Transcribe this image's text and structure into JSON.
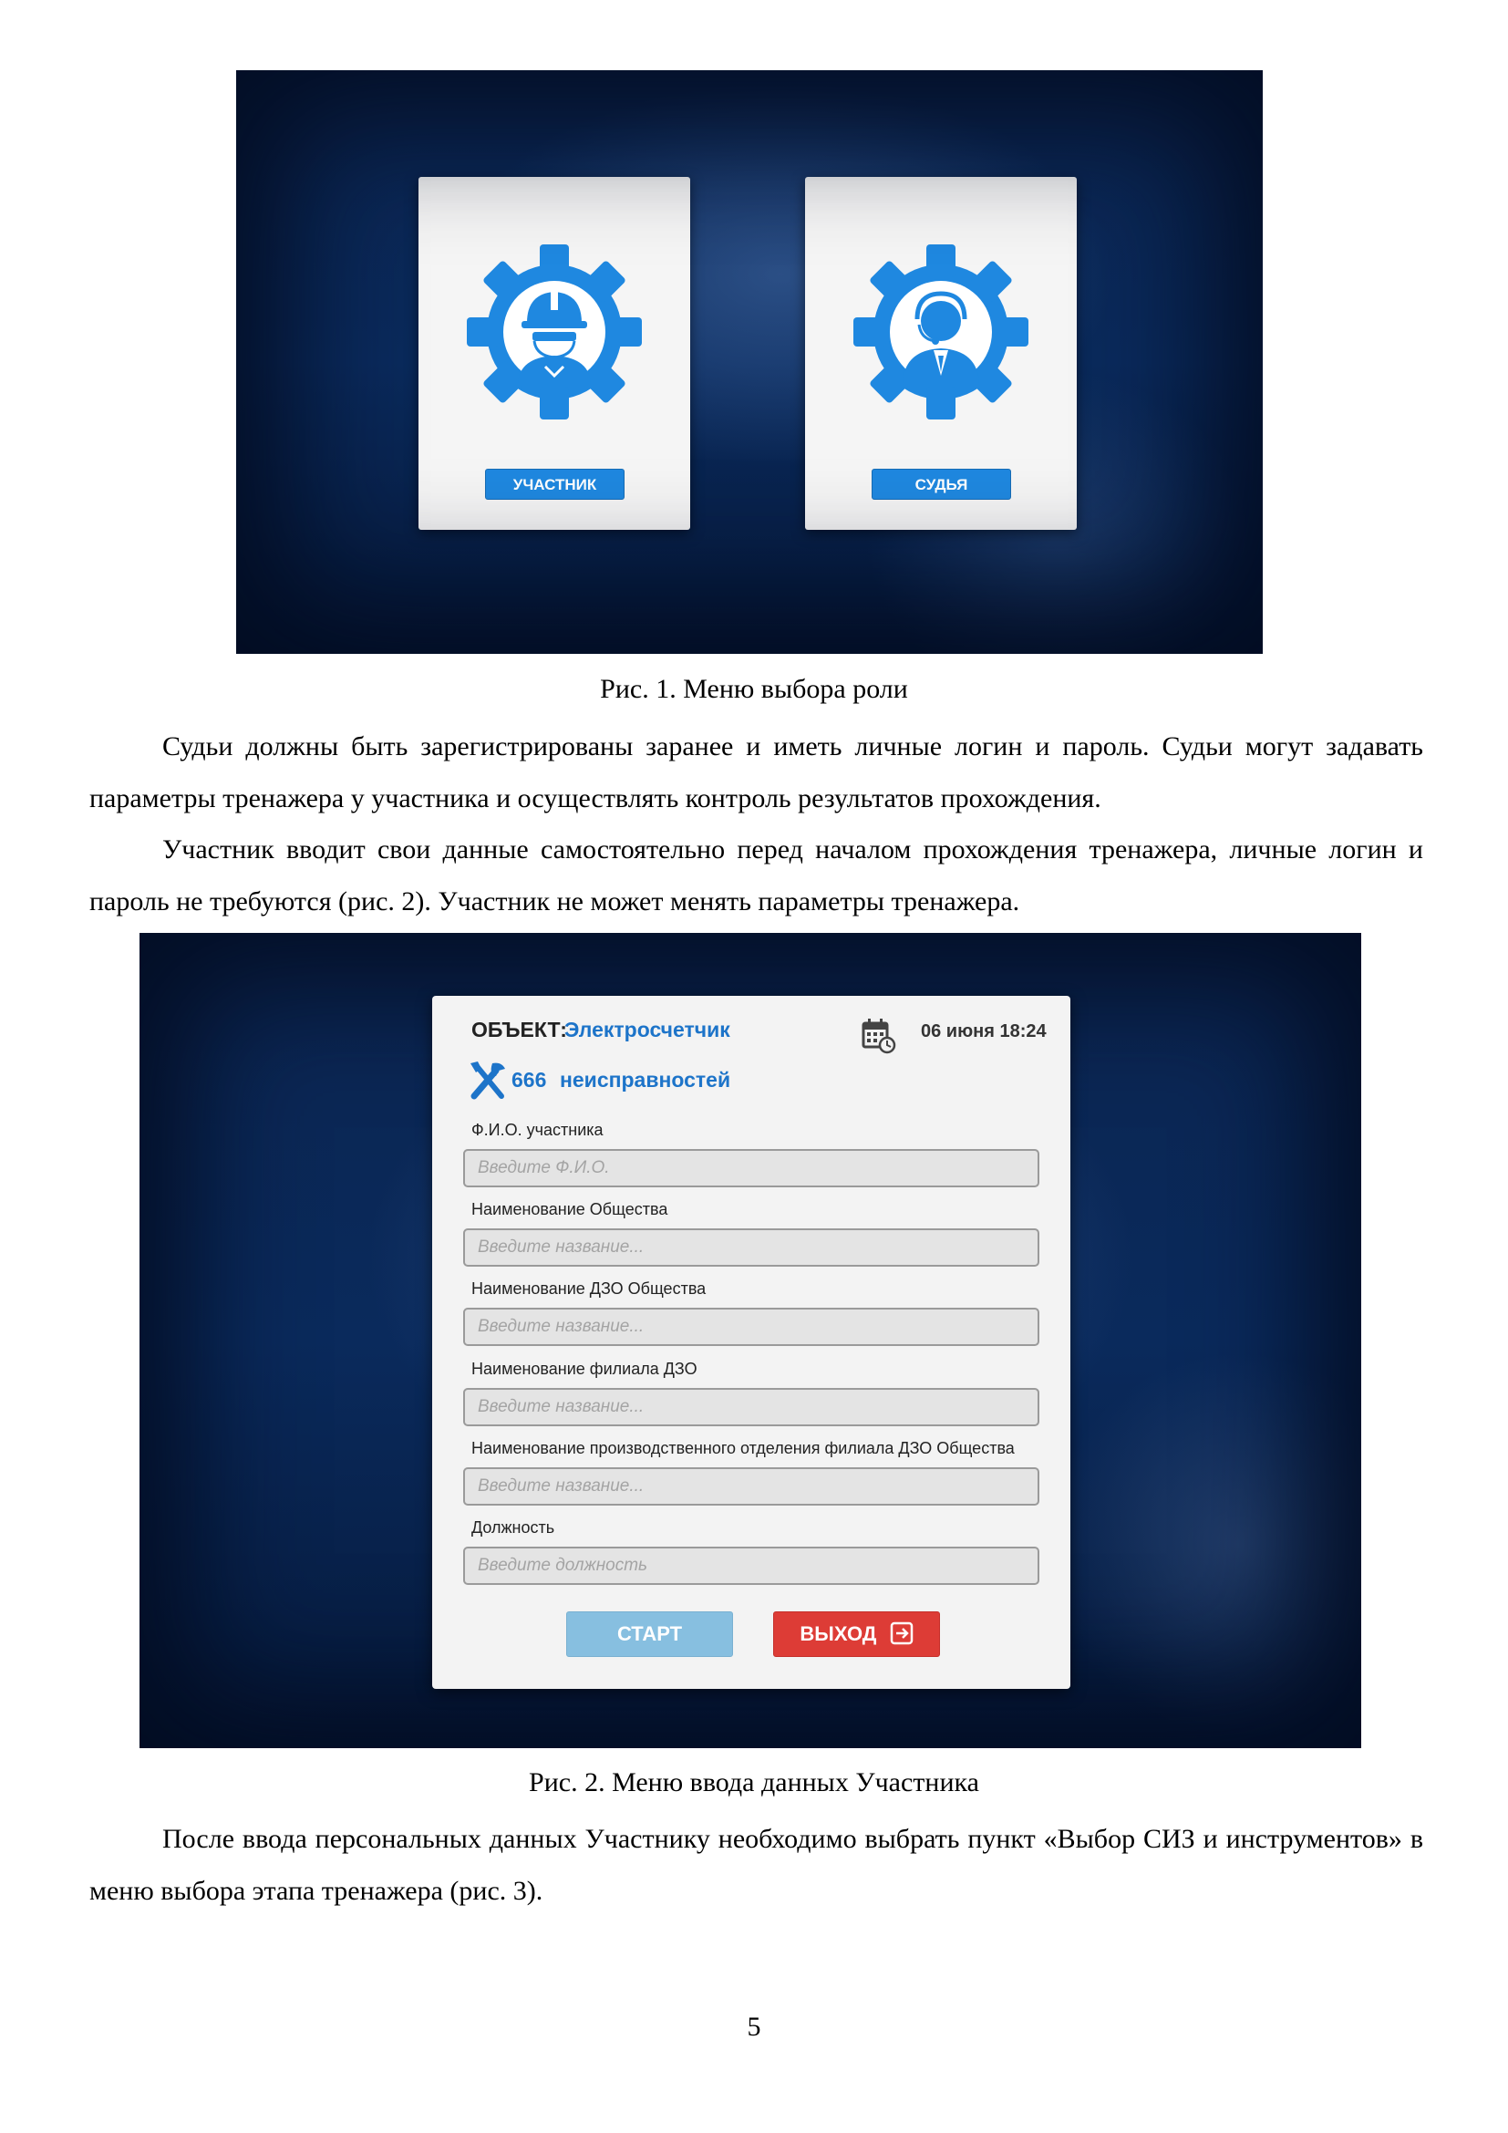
{
  "figure1": {
    "cards": [
      {
        "button_label": "УЧАСТНИК",
        "icon": "worker-gear-icon"
      },
      {
        "button_label": "СУДЬЯ",
        "icon": "operator-gear-icon"
      }
    ],
    "caption": "Рис. 1. Меню выбора роли"
  },
  "paragraphs": [
    "Судьи должны быть зарегистрированы заранее и иметь личные логин и пароль. Судьи могут задавать параметры тренажера у участника и осуществлять контроль результатов прохождения.",
    "Участник вводит свои данные самостоятельно перед началом прохождения тренажера, личные логин и пароль не требуются (рис. 2). Участник не может менять параметры тренажера.",
    "После ввода персональных данных Участнику необходимо выбрать пункт «Выбор СИЗ и инструментов» в меню выбора этапа тренажера (рис. 3)."
  ],
  "figure2": {
    "object_label": "ОБЪЕКТ:",
    "object_value": "Электросчетчик",
    "date": "06 июня 18:24",
    "fault_count": "666",
    "fault_text": "неисправностей",
    "fields": [
      {
        "label": "Ф.И.О. участника",
        "placeholder": "Введите Ф.И.О."
      },
      {
        "label": "Наименование Общества",
        "placeholder": "Введите название..."
      },
      {
        "label": "Наименование ДЗО Общества",
        "placeholder": "Введите название..."
      },
      {
        "label": "Наименование филиала ДЗО",
        "placeholder": "Введите название..."
      },
      {
        "label": "Наименование производственного отделения филиала ДЗО Общества",
        "placeholder": "Введите название..."
      },
      {
        "label": "Должность",
        "placeholder": "Введите должность"
      }
    ],
    "start_label": "СТАРТ",
    "exit_label": "ВЫХОД",
    "caption": "Рис. 2. Меню ввода данных Участника"
  },
  "colors": {
    "accent_blue": "#1d74c9",
    "role_button": "#1f88e0",
    "start_button": "#87bfe0",
    "exit_button": "#dd3c36"
  },
  "page_number": "5"
}
